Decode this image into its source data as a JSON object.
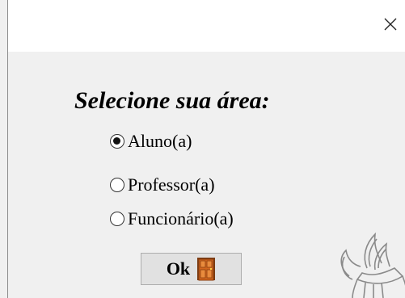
{
  "window": {
    "close_glyph": "✕"
  },
  "heading": "Selecione sua área:",
  "options": [
    {
      "label": "Aluno(a)",
      "selected": true
    },
    {
      "label": "Professor(a)",
      "selected": false
    },
    {
      "label": "Funcionário(a)",
      "selected": false
    }
  ],
  "ok_button": {
    "label": "Ok",
    "icon": "door-icon"
  },
  "logo": {
    "icon": "flame-book-logo-icon"
  },
  "colors": {
    "window_background": "#f0f0f0",
    "titlebar_background": "#ffffff",
    "door_color": "#c8561a"
  }
}
